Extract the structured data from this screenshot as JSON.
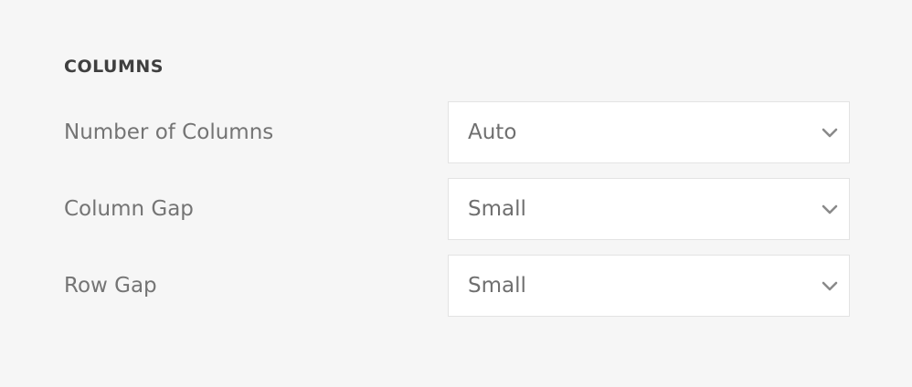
{
  "section": {
    "title": "COLUMNS"
  },
  "fields": [
    {
      "label": "Number of Columns",
      "value": "Auto",
      "icon": "chevron-down-icon"
    },
    {
      "label": "Column Gap",
      "value": "Small",
      "icon": "chevron-down-icon"
    },
    {
      "label": "Row Gap",
      "value": "Small",
      "icon": "chevron-down-icon"
    }
  ],
  "colors": {
    "background": "#f6f6f6",
    "title": "#3f3f3f",
    "label": "#747474",
    "select_background": "#ffffff",
    "select_border": "#e3e3e3",
    "chevron": "#8a8a8a"
  }
}
